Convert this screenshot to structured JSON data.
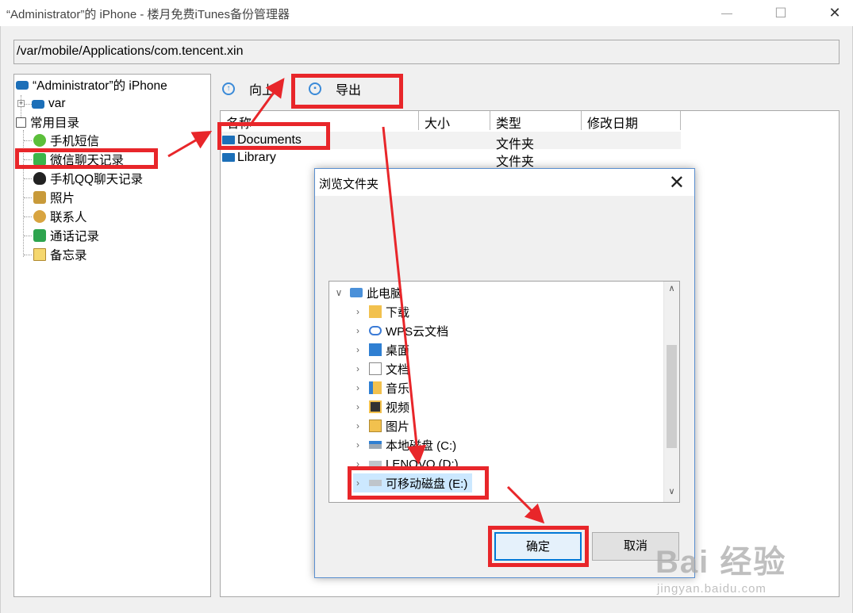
{
  "window": {
    "title": "“Administrator”的 iPhone - 楼月免费iTunes备份管理器",
    "path": "/var/mobile/Applications/com.tencent.xin"
  },
  "tree": {
    "root": "“Administrator”的 iPhone",
    "var": "var",
    "common": "常用目录",
    "items": [
      "手机短信",
      "微信聊天记录",
      "手机QQ聊天记录",
      "照片",
      "联系人",
      "通话记录",
      "备忘录"
    ]
  },
  "toolbar": {
    "up": "向上",
    "export": "导出"
  },
  "list": {
    "headers": [
      "名称",
      "大小",
      "类型",
      "修改日期"
    ],
    "rows": [
      {
        "name": "Documents",
        "type": "文件夹"
      },
      {
        "name": "Library",
        "type": "文件夹"
      }
    ]
  },
  "dialog": {
    "title": "浏览文件夹",
    "root": "此电脑",
    "items": [
      "下载",
      "WPS云文档",
      "桌面",
      "文档",
      "音乐",
      "视频",
      "图片",
      "本地磁盘 (C:)",
      "LENOVO (D:)",
      "可移动磁盘 (E:)"
    ],
    "ok": "确定",
    "cancel": "取消"
  },
  "watermark": {
    "brand": "Bai 经验",
    "url": "jingyan.baidu.com"
  },
  "colors": {
    "annotation": "#e8262a",
    "folder": "#1c6fb8",
    "accent": "#3a8ad8"
  }
}
